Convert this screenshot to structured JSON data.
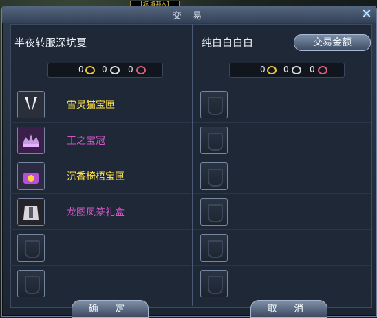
{
  "window": {
    "title": "交 易",
    "top_badge": "[城 城邦人]"
  },
  "left": {
    "player_name": "半夜转服深坑夏",
    "money": {
      "gold": "0",
      "silver": "0",
      "copper": "0"
    },
    "items": [
      {
        "name": "雪灵猫宝匣",
        "color": "#ffe14a",
        "icon": "white-wings-icon"
      },
      {
        "name": "王之宝冠",
        "color": "#d455c9",
        "icon": "crown-icon"
      },
      {
        "name": "沉香椅梧宝匣",
        "color": "#ffe14a",
        "icon": "treasure-box-icon"
      },
      {
        "name": "龙图凤篆礼盒",
        "color": "#d455c9",
        "icon": "armor-icon"
      },
      {
        "name": "",
        "color": "",
        "icon": "empty-slot-icon"
      },
      {
        "name": "",
        "color": "",
        "icon": "empty-slot-icon"
      }
    ]
  },
  "right": {
    "player_name": "纯白白白白",
    "trade_amount_button": "交易金额",
    "money": {
      "gold": "0",
      "silver": "0",
      "copper": "0"
    }
  },
  "buttons": {
    "confirm": "确 定",
    "cancel": "取 消"
  },
  "colors": {
    "gold": "#f0c838",
    "silver": "#d8dde6",
    "copper": "#e0607a"
  }
}
